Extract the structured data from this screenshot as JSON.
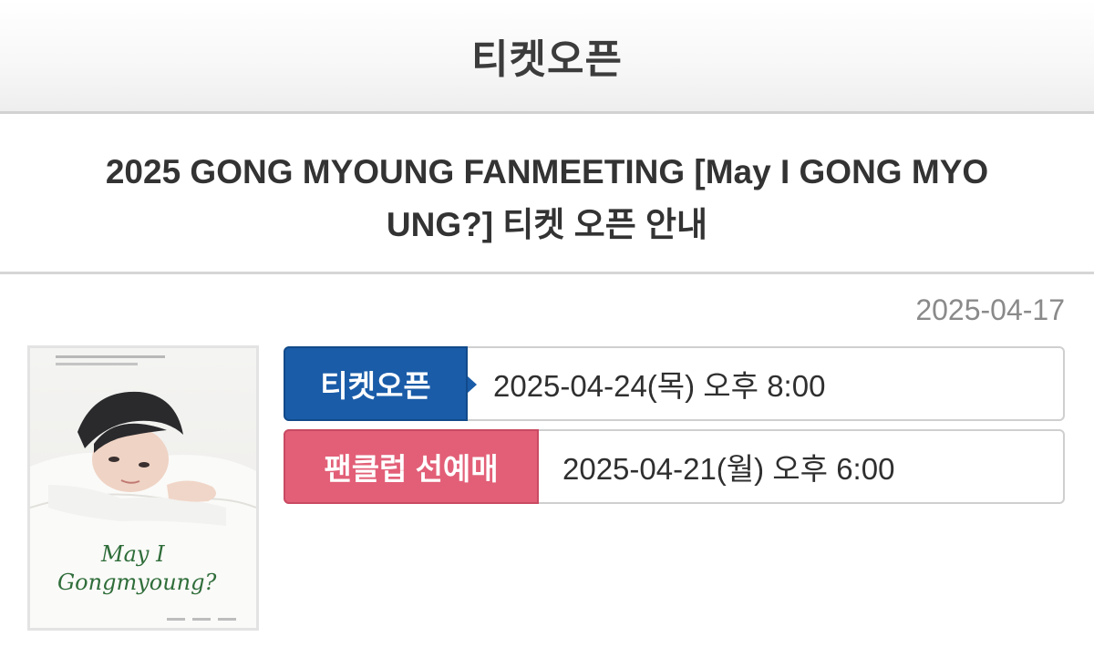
{
  "header": {
    "title": "티켓오픈"
  },
  "article": {
    "title": "2025 GONG MYOUNG FANMEETING [May I GONG MYOUNG?] 티켓 오픈 안내",
    "title_line1": "2025 GONG MYOUNG FANMEETING [May I GONG MYO",
    "title_line2": "UNG?] 티켓 오픈 안내",
    "date": "2025-04-17"
  },
  "poster": {
    "script_text_line1": "May I",
    "script_text_line2": "Gongmyoung?"
  },
  "schedule": [
    {
      "label": "티켓오픈",
      "value": "2025-04-24(목) 오후 8:00",
      "color": "#1a5ca8"
    },
    {
      "label": "팬클럽 선예매",
      "value": "2025-04-21(월) 오후 6:00",
      "color": "#e25f77"
    }
  ]
}
